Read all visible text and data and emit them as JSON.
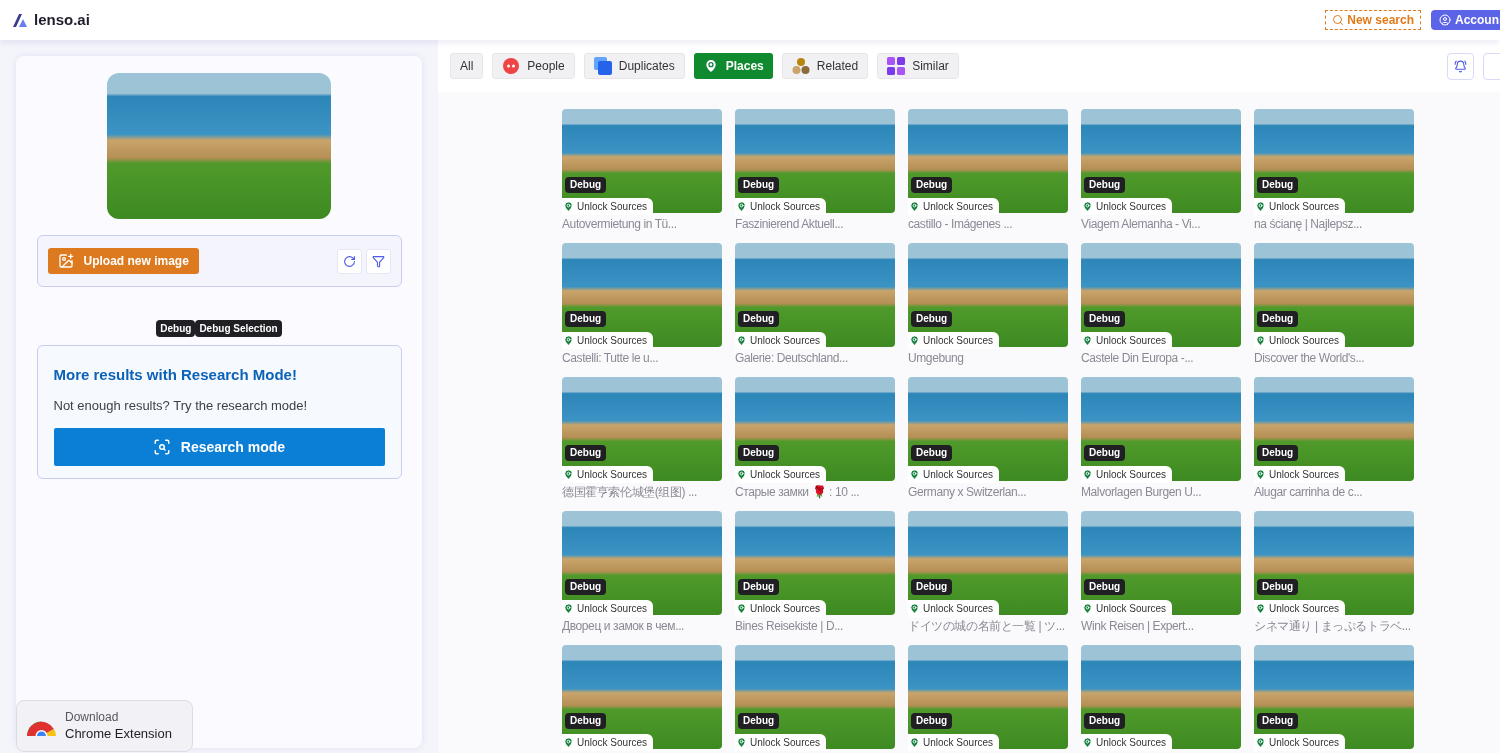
{
  "header": {
    "logo": "lenso.ai",
    "new_search": "New search",
    "account": "Accoun"
  },
  "filters": [
    {
      "label": "All",
      "kind": "all",
      "selected": false
    },
    {
      "label": "People",
      "kind": "people",
      "selected": false
    },
    {
      "label": "Duplicates",
      "kind": "duplicates",
      "selected": false
    },
    {
      "label": "Places",
      "kind": "places",
      "selected": true
    },
    {
      "label": "Related",
      "kind": "related",
      "selected": false
    },
    {
      "label": "Similar",
      "kind": "similar",
      "selected": false
    }
  ],
  "sidebar": {
    "upload_button": "Upload new image",
    "debug_tags": [
      "Debug",
      "Debug Selection"
    ],
    "research": {
      "title": "More results with Research Mode!",
      "text": "Not enough results? Try the research mode!",
      "button": "Research mode"
    },
    "extension": {
      "line1": "Download",
      "line2": "Chrome Extension"
    }
  },
  "results": [
    {
      "badge": "Debug",
      "unlock": "Unlock Sources",
      "caption": "Autovermietung in Tü..."
    },
    {
      "badge": "Debug",
      "unlock": "Unlock Sources",
      "caption": "Faszinierend Aktuell..."
    },
    {
      "badge": "Debug",
      "unlock": "Unlock Sources",
      "caption": "castillo - Imágenes ..."
    },
    {
      "badge": "Debug",
      "unlock": "Unlock Sources",
      "caption": "Viagem Alemanha - Vi..."
    },
    {
      "badge": "Debug",
      "unlock": "Unlock Sources",
      "caption": "na ścianę | Najlepsz..."
    },
    {
      "badge": "Debug",
      "unlock": "Unlock Sources",
      "caption": "Castelli: Tutte le u..."
    },
    {
      "badge": "Debug",
      "unlock": "Unlock Sources",
      "caption": "Galerie: Deutschland..."
    },
    {
      "badge": "Debug",
      "unlock": "Unlock Sources",
      "caption": "Umgebung"
    },
    {
      "badge": "Debug",
      "unlock": "Unlock Sources",
      "caption": "Castele Din Europa -..."
    },
    {
      "badge": "Debug",
      "unlock": "Unlock Sources",
      "caption": "Discover the World's..."
    },
    {
      "badge": "Debug",
      "unlock": "Unlock Sources",
      "caption": "德国霍亨索伦城堡(组图) ..."
    },
    {
      "badge": "Debug",
      "unlock": "Unlock Sources",
      "caption": "Старые замки 🌹 : 10 ..."
    },
    {
      "badge": "Debug",
      "unlock": "Unlock Sources",
      "caption": "Germany x Switzerlan..."
    },
    {
      "badge": "Debug",
      "unlock": "Unlock Sources",
      "caption": "Malvorlagen Burgen U..."
    },
    {
      "badge": "Debug",
      "unlock": "Unlock Sources",
      "caption": "Alugar carrinha de c..."
    },
    {
      "badge": "Debug",
      "unlock": "Unlock Sources",
      "caption": "Дворец и замок в чем..."
    },
    {
      "badge": "Debug",
      "unlock": "Unlock Sources",
      "caption": "Bines Reisekiste | D..."
    },
    {
      "badge": "Debug",
      "unlock": "Unlock Sources",
      "caption": "ドイツの城の名前と一覧 | ツ..."
    },
    {
      "badge": "Debug",
      "unlock": "Unlock Sources",
      "caption": "Wink Reisen | Expert..."
    },
    {
      "badge": "Debug",
      "unlock": "Unlock Sources",
      "caption": "シネマ通り | まっぷるトラベ..."
    },
    {
      "badge": "Debug",
      "unlock": "Unlock Sources"
    },
    {
      "badge": "Debug",
      "unlock": "Unlock Sources"
    },
    {
      "badge": "Debug",
      "unlock": "Unlock Sources"
    },
    {
      "badge": "Debug",
      "unlock": "Unlock Sources"
    },
    {
      "badge": "Debug",
      "unlock": "Unlock Sources"
    }
  ]
}
